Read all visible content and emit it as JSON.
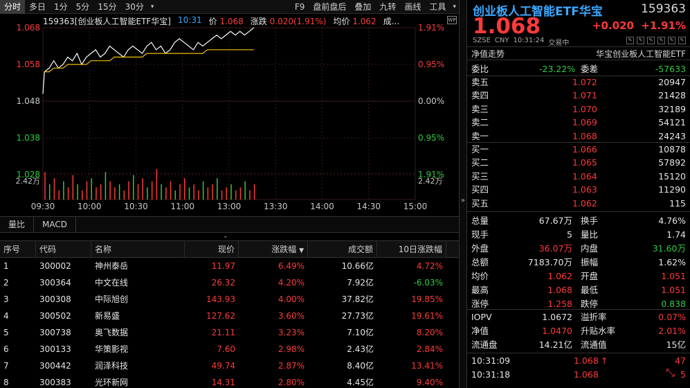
{
  "toolbar": {
    "left": [
      "分时",
      "多日",
      "1分",
      "5分",
      "15分",
      "30分"
    ],
    "right": [
      "F9",
      "盘前盘后",
      "叠加",
      "九转",
      "画线",
      "工具"
    ]
  },
  "chart_header": {
    "name": "159363[创业板人工智能ETF华宝]",
    "time": "10:31",
    "price_label": "价",
    "price": "1.068",
    "chg_label": "涨跌",
    "chg": "0.020(1.91%)",
    "avg_label": "均价",
    "avg": "1.062",
    "vol_label": "成..."
  },
  "chart_data": {
    "type": "line",
    "title": "",
    "x_ticks": [
      "09:30",
      "10:00",
      "10:30",
      "11:00",
      "13:00",
      "13:30",
      "14:00",
      "14:30",
      "15:00"
    ],
    "y_ticks_left": [
      "1.068",
      "1.058",
      "1.048",
      "1.038",
      "1.028"
    ],
    "y_ticks_right": [
      "1.91%",
      "0.95%",
      "0.00%",
      "0.95%",
      "1.91%"
    ],
    "ylim": [
      1.028,
      1.068
    ],
    "prev_close": 1.048,
    "volume_label": "2.42万",
    "series": [
      {
        "name": "价",
        "values": [
          1.056,
          1.057,
          1.059,
          1.057,
          1.058,
          1.06,
          1.059,
          1.061,
          1.058,
          1.06,
          1.061,
          1.062,
          1.06,
          1.061,
          1.063,
          1.062,
          1.061,
          1.06,
          1.062,
          1.063,
          1.062,
          1.061,
          1.063,
          1.064,
          1.062,
          1.063,
          1.061,
          1.062,
          1.064,
          1.065,
          1.064,
          1.063,
          1.062,
          1.064,
          1.063,
          1.064,
          1.065,
          1.066,
          1.065,
          1.066,
          1.067,
          1.066,
          1.067,
          1.066,
          1.067,
          1.068
        ]
      },
      {
        "name": "均价",
        "values": [
          1.056,
          1.056,
          1.057,
          1.057,
          1.057,
          1.058,
          1.058,
          1.058,
          1.058,
          1.058,
          1.059,
          1.059,
          1.059,
          1.059,
          1.059,
          1.06,
          1.06,
          1.06,
          1.06,
          1.06,
          1.06,
          1.06,
          1.061,
          1.061,
          1.061,
          1.061,
          1.061,
          1.061,
          1.061,
          1.061,
          1.061,
          1.061,
          1.061,
          1.061,
          1.061,
          1.062,
          1.062,
          1.062,
          1.062,
          1.062,
          1.062,
          1.062,
          1.062,
          1.062,
          1.062,
          1.062
        ]
      }
    ],
    "volumes": [
      0.9,
      0.5,
      0.7,
      0.3,
      0.6,
      0.4,
      0.8,
      0.5,
      0.3,
      0.6,
      0.7,
      0.4,
      0.5,
      0.9,
      0.6,
      0.4,
      0.5,
      0.3,
      0.6,
      0.8,
      0.5,
      0.7,
      0.4,
      0.6,
      1.0,
      0.5,
      0.4,
      0.6,
      0.3,
      0.5,
      0.7,
      0.4,
      0.5,
      0.3,
      0.6,
      0.4,
      0.5,
      0.7,
      0.3,
      0.4,
      0.5,
      0.3,
      0.4,
      0.6,
      0.3,
      0.5
    ]
  },
  "subtabs": [
    "量比",
    "MACD"
  ],
  "table": {
    "headers": [
      "序号",
      "代码",
      "名称",
      "现价",
      "涨跌幅",
      "成交额",
      "10日涨跌幅"
    ],
    "rows": [
      [
        "1",
        "300002",
        "神州泰岳",
        "11.97",
        "6.49%",
        "10.66亿",
        "4.72%"
      ],
      [
        "2",
        "300364",
        "中文在线",
        "26.32",
        "4.20%",
        "7.92亿",
        "-6.03%"
      ],
      [
        "3",
        "300308",
        "中际旭创",
        "143.93",
        "4.00%",
        "37.82亿",
        "19.85%"
      ],
      [
        "4",
        "300502",
        "新易盛",
        "127.62",
        "3.60%",
        "27.73亿",
        "19.61%"
      ],
      [
        "5",
        "300738",
        "奥飞数据",
        "21.11",
        "3.23%",
        "7.10亿",
        "8.20%"
      ],
      [
        "6",
        "300133",
        "华策影视",
        "7.60",
        "2.98%",
        "2.43亿",
        "2.84%"
      ],
      [
        "7",
        "300442",
        "润泽科技",
        "49.74",
        "2.87%",
        "8.40亿",
        "13.41%"
      ],
      [
        "8",
        "300383",
        "光环新网",
        "14.31",
        "2.80%",
        "4.45亿",
        "9.40%"
      ]
    ]
  },
  "quote": {
    "title": "创业板人工智能ETF华宝",
    "code": "159363",
    "price": "1.068",
    "change": "+0.020",
    "change_pct": "+1.91%",
    "market": "SZSE",
    "currency": "CNY",
    "time": "10:31:24",
    "status": "交易中",
    "nav_left": "净值走势",
    "nav_right": "华宝创业板人工智能ETF",
    "weibi_label": "委比",
    "weibi": "-23.22%",
    "weicha_label": "委差",
    "weicha": "-57633",
    "asks": [
      {
        "label": "卖五",
        "price": "1.072",
        "vol": "20947"
      },
      {
        "label": "卖四",
        "price": "1.071",
        "vol": "21428"
      },
      {
        "label": "卖三",
        "price": "1.070",
        "vol": "32189"
      },
      {
        "label": "卖二",
        "price": "1.069",
        "vol": "54121"
      },
      {
        "label": "卖一",
        "price": "1.068",
        "vol": "24243"
      }
    ],
    "bids": [
      {
        "label": "买一",
        "price": "1.066",
        "vol": "10878"
      },
      {
        "label": "买二",
        "price": "1.065",
        "vol": "57892"
      },
      {
        "label": "买三",
        "price": "1.064",
        "vol": "15120"
      },
      {
        "label": "买四",
        "price": "1.063",
        "vol": "11290"
      },
      {
        "label": "买五",
        "price": "1.062",
        "vol": "115"
      }
    ],
    "stats": [
      {
        "l1": "总量",
        "v1": "67.67万",
        "c1": "white",
        "l2": "换手",
        "v2": "4.76%",
        "c2": "white"
      },
      {
        "l1": "现手",
        "v1": "5",
        "c1": "white",
        "l2": "量比",
        "v2": "1.74",
        "c2": "white"
      },
      {
        "l1": "外盘",
        "v1": "36.07万",
        "c1": "red",
        "l2": "内盘",
        "v2": "31.60万",
        "c2": "green"
      },
      {
        "l1": "总额",
        "v1": "7183.70万",
        "c1": "white",
        "l2": "振幅",
        "v2": "1.62%",
        "c2": "white"
      },
      {
        "l1": "均价",
        "v1": "1.062",
        "c1": "red",
        "l2": "开盘",
        "v2": "1.051",
        "c2": "red"
      },
      {
        "l1": "最高",
        "v1": "1.068",
        "c1": "red",
        "l2": "最低",
        "v2": "1.051",
        "c2": "red"
      },
      {
        "l1": "涨停",
        "v1": "1.258",
        "c1": "red",
        "l2": "跌停",
        "v2": "0.838",
        "c2": "green"
      }
    ],
    "iopv": [
      {
        "l1": "IOPV",
        "v1": "1.0672",
        "c1": "white",
        "l2": "溢折率",
        "v2": "0.07%",
        "c2": "red"
      },
      {
        "l1": "净值",
        "v1": "1.0470",
        "c1": "red",
        "l2": "升贴水率",
        "v2": "2.01%",
        "c2": "red"
      },
      {
        "l1": "流通盘",
        "v1": "14.21亿",
        "c1": "white",
        "l2": "流通值",
        "v2": "15亿",
        "c2": "white"
      }
    ],
    "ticks": [
      {
        "time": "10:31:09",
        "price": "1.068",
        "vol": "47"
      },
      {
        "time": "10:31:18",
        "price": "1.068",
        "vol": "5"
      }
    ]
  }
}
